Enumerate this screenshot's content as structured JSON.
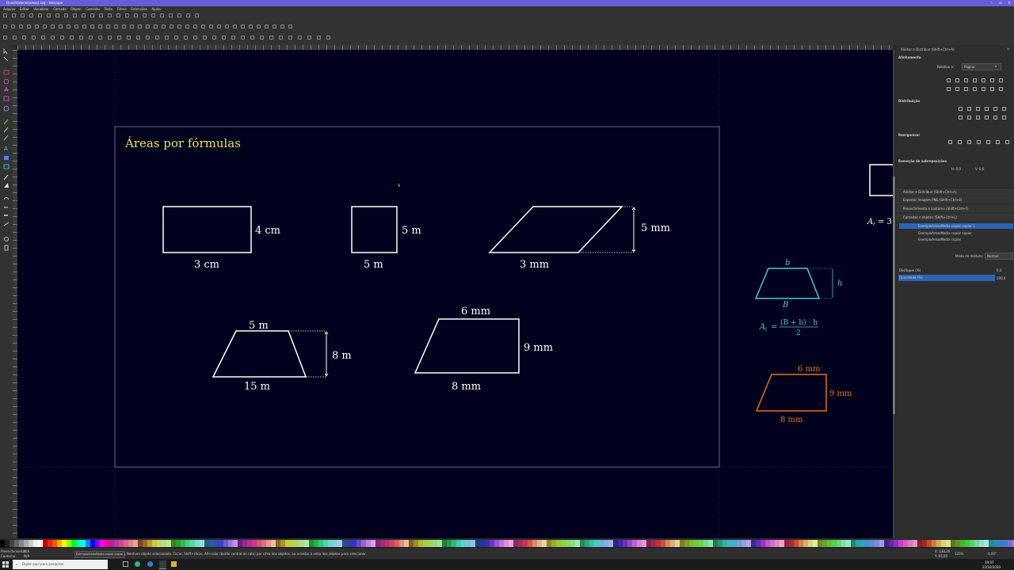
{
  "window": {
    "title": "Quadrilateros(areas).svg - Inkscape"
  },
  "menu": [
    "Arquivo",
    "Editar",
    "Visualizar",
    "Camada",
    "Objeto",
    "Caminho",
    "Texto",
    "Filtros",
    "Extensões",
    "Ajuda"
  ],
  "canvas": {
    "title": "Áreas por fórmulas",
    "shapes": {
      "rect_base": "3 cm",
      "rect_height": "4 cm",
      "square_base": "5 m",
      "square_side": "5 m",
      "para_base": "3 mm",
      "para_height": "5 mm",
      "trap_top": "5 m",
      "trap_bottom": "15 m",
      "trap_height": "8 m",
      "rtrap_top": "6 mm",
      "rtrap_bottom": "8 mm",
      "rtrap_height": "9 mm"
    },
    "side": {
      "trap_b": "b",
      "trap_B": "B",
      "trap_h": "h",
      "formula_lhs": "A",
      "formula_sub": "t",
      "formula_num": "(B + b) · h",
      "formula_den": "2",
      "orange_top": "6 mm",
      "orange_side": "9 mm",
      "orange_bottom": "8 mm",
      "ar_label": "A",
      "ar_sub": "r",
      "ar_rest": "= 3"
    }
  },
  "panel": {
    "header": "Alinhar e Distribuir (Shift+Ctrl+A)",
    "align_title": "Alinhamento",
    "relative_label": "Relativo a:",
    "relative_value": "Página",
    "distribute_title": "Distribuição",
    "no_overlap": "Sem sobreposição",
    "rearrange_title": "Reorganizar",
    "remove_overlap_title": "Remoção de sobreposições",
    "h_label": "H: 0,0",
    "v_label": "V: 0,0",
    "docks": [
      "Alinhar e Distribuir (Shift+Ctrl+A)",
      "Exportar Imagem PNG (Shift+Ctrl+E)",
      "Preenchimento e contorno (Shift+Ctrl+F)",
      "Camadas e objetos (Shift+Ctrl+L)"
    ],
    "layers": [
      "ExemploAreasMedia copiar copiar 1",
      "ExemploAreasMedia copiar copiar",
      "ExemploAreasMedia copiar"
    ],
    "blend_label": "Modo de mistura:",
    "blend_value": "Normal",
    "blur_label": "Desfoque (%)",
    "blur_value": "0,0",
    "opacity_label": "Opacidade (%)",
    "opacity_value": "100,0"
  },
  "status": {
    "fill_label": "Preenchimento:",
    "fill_value": "N/A",
    "stroke_label": "Contorno:",
    "stroke_value": "N/A",
    "layer": "ExemploAreasMedia copiar copiar 1",
    "message": "Nenhum objeto selecionado. Clicar, Shift+clicar, Alt+rolar (botão central do rato) por cima dos objetos, ou arrastar à volta dos objetos para selecionar.",
    "x": "X: 238,26",
    "y": "Y: 65,00",
    "zoom": "120%",
    "rotation": "0,00°"
  },
  "taskbar": {
    "search_placeholder": "Digite aqui para pesquisar",
    "time": "19:07",
    "date": "22/10/2020"
  },
  "colors": {
    "canvas_bg": "#02021e",
    "cyan": "#53c6d0",
    "orange": "#e0731c",
    "title_yellow": "#e8e04a",
    "accent": "#6b5bd6"
  }
}
